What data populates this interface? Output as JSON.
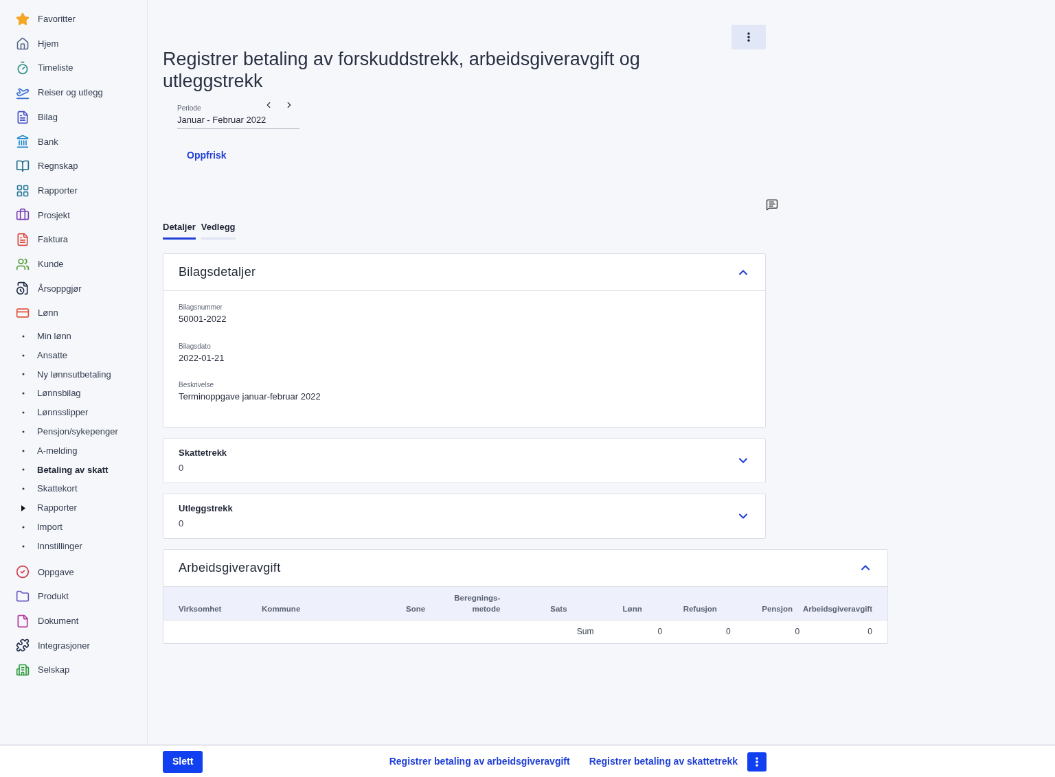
{
  "sidebar": {
    "items": [
      {
        "label": "Favoritter"
      },
      {
        "label": "Hjem"
      },
      {
        "label": "Timeliste"
      },
      {
        "label": "Reiser og utlegg"
      },
      {
        "label": "Bilag"
      },
      {
        "label": "Bank"
      },
      {
        "label": "Regnskap"
      },
      {
        "label": "Rapporter"
      },
      {
        "label": "Prosjekt"
      },
      {
        "label": "Faktura"
      },
      {
        "label": "Kunde"
      },
      {
        "label": "Årsoppgjør"
      },
      {
        "label": "Lønn",
        "children": [
          {
            "label": "Min lønn",
            "kind": "leaf",
            "selected": false
          },
          {
            "label": "Ansatte",
            "kind": "leaf",
            "selected": false
          },
          {
            "label": "Ny lønnsutbetaling",
            "kind": "leaf",
            "selected": false
          },
          {
            "label": "Lønnsbilag",
            "kind": "leaf",
            "selected": false
          },
          {
            "label": "Lønnsslipper",
            "kind": "leaf",
            "selected": false
          },
          {
            "label": "Pensjon/sykepenger",
            "kind": "leaf",
            "selected": false
          },
          {
            "label": "A-melding",
            "kind": "leaf",
            "selected": false
          },
          {
            "label": "Betaling av skatt",
            "kind": "leaf",
            "selected": true
          },
          {
            "label": "Skattekort",
            "kind": "leaf",
            "selected": false
          },
          {
            "label": "Rapporter",
            "kind": "folder",
            "selected": false
          },
          {
            "label": "Import",
            "kind": "leaf",
            "selected": false
          },
          {
            "label": "Innstillinger",
            "kind": "leaf",
            "selected": false
          }
        ]
      },
      {
        "label": "Oppgave"
      },
      {
        "label": "Produkt"
      },
      {
        "label": "Dokument"
      },
      {
        "label": "Integrasjoner"
      },
      {
        "label": "Selskap"
      }
    ]
  },
  "page": {
    "title": "Registrer betaling av forskuddstrekk, arbeidsgiveravgift og utleggstrekk",
    "period": {
      "label": "Periode",
      "value": "Januar - Februar 2022"
    },
    "refresh": "Oppfrisk"
  },
  "tabs": [
    {
      "label": "Detaljer",
      "selected": true
    },
    {
      "label": "Vedlegg",
      "selected": false
    }
  ],
  "details": {
    "title": "Bilagsdetaljer",
    "expanded": true,
    "fields": [
      {
        "label": "Bilagsnummer",
        "value": "50001-2022"
      },
      {
        "label": "Bilagsdato",
        "value": "2022-01-21"
      },
      {
        "label": "Beskrivelse",
        "value": "Terminoppgave januar-februar 2022"
      }
    ]
  },
  "summaries": [
    {
      "title": "Skattetrekk",
      "value": "0",
      "expanded": false
    },
    {
      "title": "Utleggstrekk",
      "value": "0",
      "expanded": false
    }
  ],
  "employer_fee": {
    "title": "Arbeidsgiveravgift",
    "expanded": true,
    "columns": [
      "Virksomhet",
      "Kommune",
      "Sone",
      "Beregnings-\nmetode",
      "Sats",
      "Lønn",
      "Refusjon",
      "Pensjon",
      "Arbeidsgiveravgift"
    ],
    "sum_row": {
      "label": "Sum",
      "values": [
        "0",
        "0",
        "0",
        "0"
      ]
    }
  },
  "footer": {
    "delete": "Slett",
    "links": [
      "Registrer betaling av arbeidsgiveravgift",
      "Registrer betaling av skattetrekk"
    ]
  }
}
